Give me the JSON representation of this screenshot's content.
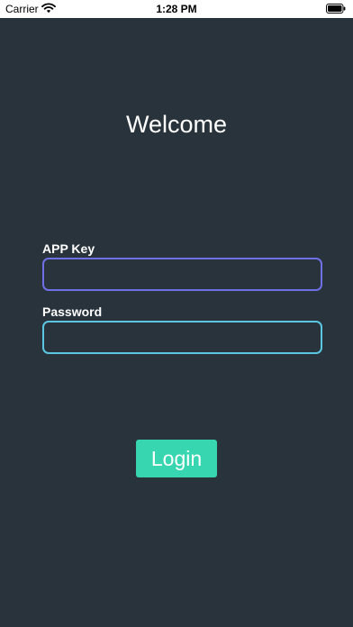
{
  "status_bar": {
    "carrier": "Carrier",
    "time": "1:28 PM",
    "wifi_icon": "wifi-icon",
    "battery_icon": "battery-icon"
  },
  "screen": {
    "title": "Welcome",
    "app_key": {
      "label": "APP Key",
      "value": "",
      "placeholder": ""
    },
    "password": {
      "label": "Password",
      "value": "",
      "placeholder": ""
    },
    "login_label": "Login"
  },
  "colors": {
    "background": "#29333b",
    "app_key_border": "#6f6fe6",
    "password_border": "#5cc6e2",
    "login_button": "#37d6b1"
  }
}
